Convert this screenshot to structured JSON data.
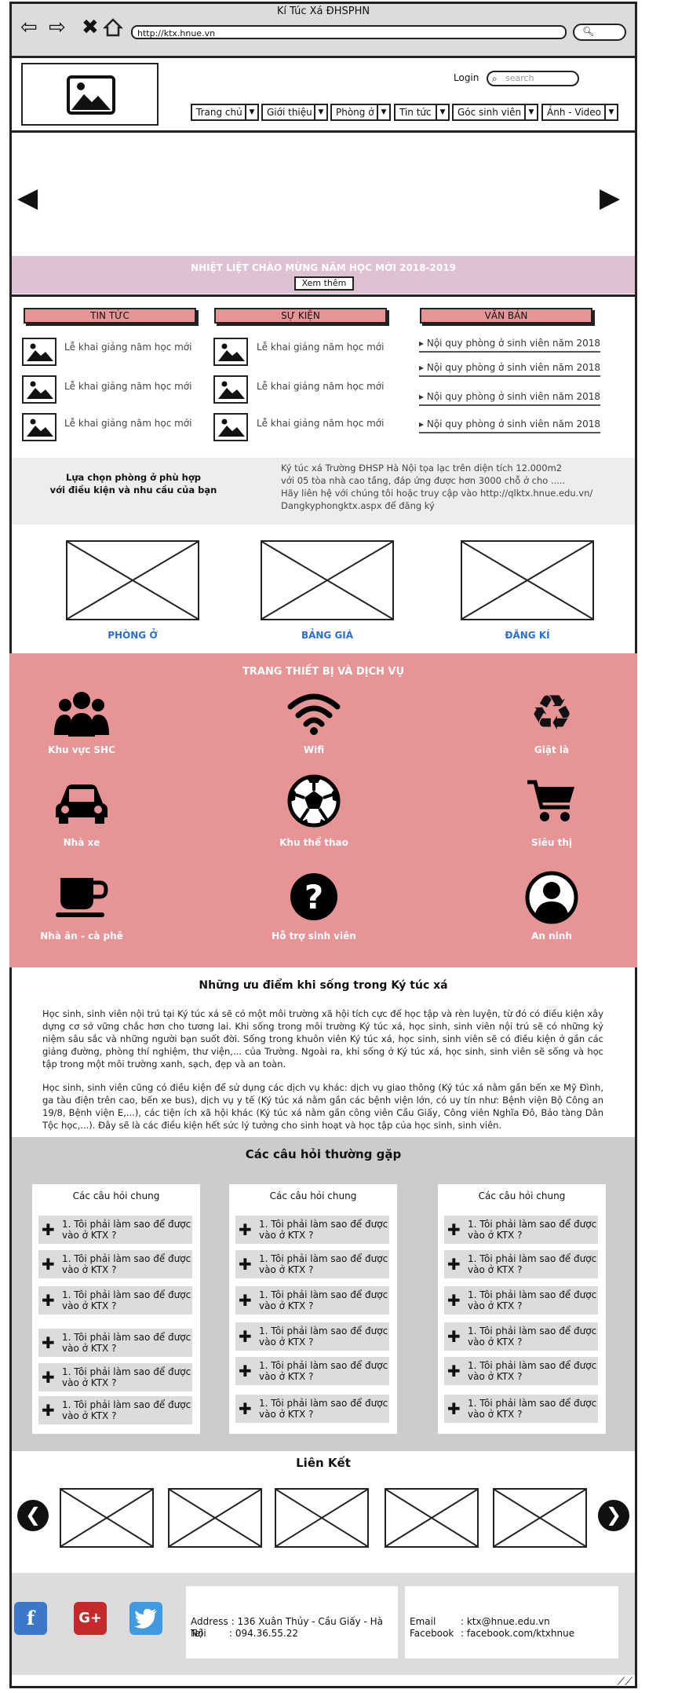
{
  "browser": {
    "title": "Kí Túc Xá ĐHSPHN",
    "url": "http://ktx.hnue.vn"
  },
  "header": {
    "login": "Login",
    "search_placeholder": "search",
    "menu": [
      "Trang chủ",
      "Giới thiệu",
      "Phòng ở",
      "Tin tức",
      "Góc sinh viên",
      "Ảnh - Video"
    ]
  },
  "banner": {
    "text": "NHIỆT LIỆT CHÀO MỪNG NĂM HỌC MỚI 2018-2019",
    "button": "Xem thêm"
  },
  "columns": {
    "news": {
      "heading": "TIN TỨC",
      "items": [
        "Lễ khai giảng năm học mới",
        "Lễ khai giảng năm học mới",
        "Lễ khai giảng năm học mới"
      ]
    },
    "events": {
      "heading": "SỰ KIỆN",
      "items": [
        "Lễ khai giảng năm học mới",
        "Lễ khai giảng năm học mới",
        "Lễ khai giảng năm học mới"
      ]
    },
    "docs": {
      "heading": "VĂN BẢN",
      "items": [
        "Nội quy phòng ở sinh viên năm 2018",
        "Nội quy phòng ở sinh viên năm 2018",
        "Nội quy phòng ở sinh viên năm 2018",
        "Nội quy phòng ở sinh viên năm 2018"
      ]
    }
  },
  "info": {
    "left_line1": "Lựa chọn phòng ở phù hợp",
    "left_line2": "với điều kiện và nhu cầu của bạn",
    "right_line1": "Ký túc xá Trường ĐHSP Hà Nội tọa lạc trên diện tích 12.000m2",
    "right_line2": "với 05 tòa nhà cao tầng, đáp ứng được hơn 3000 chỗ ở cho .....",
    "right_line3": "Hãy liên hệ với chúng tôi hoặc truy cập vào http://qlktx.hnue.edu.vn/",
    "right_line4": "Dangkyphongktx.aspx để đăng ký"
  },
  "rooms": [
    "PHÒNG Ở",
    "BẢNG GIÁ",
    "ĐĂNG KÍ"
  ],
  "services": {
    "title": "TRANG THIẾT BỊ VÀ DỊCH VỤ",
    "items": [
      {
        "label": "Khu vực SHC",
        "icon": "people-icon"
      },
      {
        "label": "Wifi",
        "icon": "wifi-icon"
      },
      {
        "label": "Giặt là",
        "icon": "recycle-icon"
      },
      {
        "label": "Nhà xe",
        "icon": "car-icon"
      },
      {
        "label": "Khu thể thao",
        "icon": "soccer-ball-icon"
      },
      {
        "label": "Siêu thị",
        "icon": "cart-icon"
      },
      {
        "label": "Nhà ăn - cà phê",
        "icon": "coffee-cup-icon"
      },
      {
        "label": "Hỗ trợ sinh viên",
        "icon": "question-icon"
      },
      {
        "label": "An ninh",
        "icon": "user-circle-icon"
      }
    ]
  },
  "advantages": {
    "title": "Những ưu điểm khi sống trong Ký túc xá",
    "p1": "Học sinh, sinh viên nội trú tại Ký túc xá sẽ có một môi trường xã hội tích cực để học tập và rèn luyện, từ đó có điều kiện xây dựng cơ sở vững chắc hơn cho tương lai. Khi sống trong môi trường Ký túc xá, học sinh, sinh viên nội trú sẽ có những kỷ niệm sâu sắc và những người bạn suốt đời. Sống trong khuôn viên Ký túc xá, học sinh, sinh viên sẽ có điều kiện ở gần các giảng đường, phòng thí nghiệm, thư viện,... của Trường. Ngoài ra, khi sống ở Ký túc xá, học sinh, sinh viên sẽ sống và học tập trong một môi trường xanh, sạch, đẹp và an toàn.",
    "p2": "Học sinh, sinh viên cũng có điều kiện để sử dụng các dịch vụ khác: dịch vụ giao thông (Ký túc xá nằm gần bến xe Mỹ Đình, ga tàu điện trên cao, bến xe bus), dịch vụ y tế (Ký túc xá nằm gần các bệnh viện lớn, có uy tín như: Bệnh viện Bộ Công an 19/8, Bệnh viện E,...), các tiện ích xã hội khác (Ký túc xá nằm gần công viên Cầu Giấy, Công viên Nghĩa Đô, Bảo tàng Dân Tộc học,...). Đây sẽ là các điều kiện hết sức lý tưởng cho sinh hoạt và học tập của học sinh, sinh viên."
  },
  "faq": {
    "title": "Các câu hỏi thường gặp",
    "cards": [
      {
        "title": "Các câu hỏi chung",
        "items": [
          "1. Tôi phải làm sao để được vào ở KTX ?",
          "1. Tôi phải làm sao để được vào ở KTX ?",
          "1. Tôi phải làm sao để được vào ở KTX ?",
          "1. Tôi phải làm sao để được vào ở KTX ?",
          "1. Tôi phải làm sao để được vào ở KTX ?",
          "1. Tôi phải làm sao để được vào ở KTX ?"
        ]
      },
      {
        "title": "Các câu hỏi chung",
        "items": [
          "1. Tôi phải làm sao để được vào ở KTX ?",
          "1. Tôi phải làm sao để được vào ở KTX ?",
          "1. Tôi phải làm sao để được vào ở KTX ?",
          "1. Tôi phải làm sao để được vào ở KTX ?",
          "1. Tôi phải làm sao để được vào ở KTX ?",
          "1. Tôi phải làm sao để được vào ở KTX ?"
        ]
      },
      {
        "title": "Các câu hỏi chung",
        "items": [
          "1. Tôi phải làm sao để được vào ở KTX ?",
          "1. Tôi phải làm sao để được vào ở KTX ?",
          "1. Tôi phải làm sao để được vào ở KTX ?",
          "1. Tôi phải làm sao để được vào ở KTX ?",
          "1. Tôi phải làm sao để được vào ở KTX ?",
          "1. Tôi phải làm sao để được vào ở KTX ?"
        ]
      }
    ]
  },
  "links": {
    "title": "Liên Kết"
  },
  "footer": {
    "address_label": "Address",
    "address": ": 136 Xuân Thủy - Cầu Giấy - Hà Nội",
    "tel_label": "Tel",
    "tel": ": 094.36.55.22",
    "email_label": "Email",
    "email": ": ktx@hnue.edu.vn",
    "facebook_label": "Facebook",
    "facebook": ": facebook.com/ktxhnue"
  },
  "colors": {
    "accent_pink": "#e69496",
    "banner_pink": "#dfc1d5",
    "link_blue": "#2b6fd1"
  }
}
